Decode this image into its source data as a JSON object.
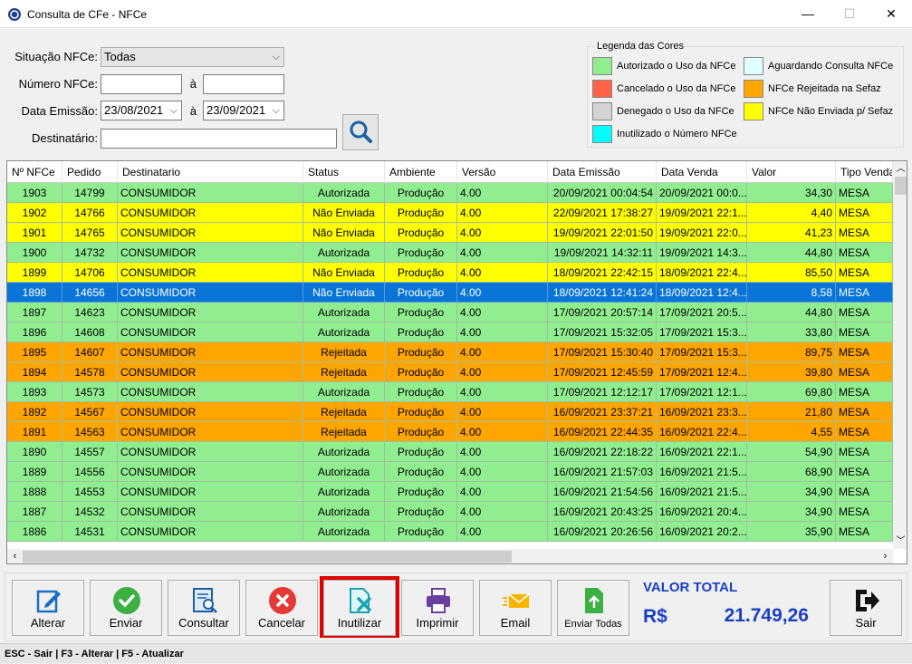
{
  "window": {
    "title": "Consulta de CFe - NFCe"
  },
  "filters": {
    "situacao_label": "Situação NFCe:",
    "situacao_value": "Todas",
    "numero_label": "Número NFCe:",
    "numero_from": "",
    "numero_to": "",
    "a_label": "à",
    "data_label": "Data Emissão:",
    "data_from": "23/08/2021",
    "data_to": "23/09/2021",
    "destinatario_label": "Destinatário:",
    "destinatario_value": ""
  },
  "legend": {
    "title": "Legenda das Cores",
    "items": [
      {
        "label": "Autorizado o Uso da NFCe",
        "color": "#90ee90"
      },
      {
        "label": "Aguardando Consulta NFCe",
        "color": "#e0ffff"
      },
      {
        "label": "Cancelado o Uso da NFCe",
        "color": "#ff6347"
      },
      {
        "label": "NFCe Rejeitada na Sefaz",
        "color": "#ffa500"
      },
      {
        "label": "Denegado o Uso da NFCe",
        "color": "#d3d3d3"
      },
      {
        "label": "NFCe Não Enviada p/ Sefaz",
        "color": "#ffff00"
      },
      {
        "label": "Inutilizado o Número NFCe",
        "color": "#00ffff"
      }
    ]
  },
  "grid": {
    "columns": [
      "Nº NFCe",
      "Pedido",
      "Destinatario",
      "Status",
      "Ambiente",
      "Versão",
      "Data Emissão",
      "Data Venda",
      "Valor",
      "Tipo Venda"
    ],
    "rows": [
      {
        "nfce": "1903",
        "pedido": "14799",
        "dest": "CONSUMIDOR",
        "status": "Autorizada",
        "amb": "Produção",
        "ver": "4.00",
        "emissao": "20/09/2021 00:04:54",
        "venda": "20/09/2021 00:0...",
        "valor": "34,30",
        "tipo": "MESA",
        "color": "#90ee90"
      },
      {
        "nfce": "1902",
        "pedido": "14766",
        "dest": "CONSUMIDOR",
        "status": "Não Enviada",
        "amb": "Produção",
        "ver": "4.00",
        "emissao": "22/09/2021 17:38:27",
        "venda": "19/09/2021 22:1...",
        "valor": "4,40",
        "tipo": "MESA",
        "color": "#ffff00"
      },
      {
        "nfce": "1901",
        "pedido": "14765",
        "dest": "CONSUMIDOR",
        "status": "Não Enviada",
        "amb": "Produção",
        "ver": "4.00",
        "emissao": "19/09/2021 22:01:50",
        "venda": "19/09/2021 22:0...",
        "valor": "41,23",
        "tipo": "MESA",
        "color": "#ffff00"
      },
      {
        "nfce": "1900",
        "pedido": "14732",
        "dest": "CONSUMIDOR",
        "status": "Autorizada",
        "amb": "Produção",
        "ver": "4.00",
        "emissao": "19/09/2021 14:32:11",
        "venda": "19/09/2021 14:3...",
        "valor": "44,80",
        "tipo": "MESA",
        "color": "#90ee90"
      },
      {
        "nfce": "1899",
        "pedido": "14706",
        "dest": "CONSUMIDOR",
        "status": "Não Enviada",
        "amb": "Produção",
        "ver": "4.00",
        "emissao": "18/09/2021 22:42:15",
        "venda": "18/09/2021 22:4...",
        "valor": "85,50",
        "tipo": "MESA",
        "color": "#ffff00"
      },
      {
        "nfce": "1898",
        "pedido": "14656",
        "dest": "CONSUMIDOR",
        "status": "Não Enviada",
        "amb": "Produção",
        "ver": "4.00",
        "emissao": "18/09/2021 12:41:24",
        "venda": "18/09/2021 12:4...",
        "valor": "8,58",
        "tipo": "MESA",
        "color": "#0a74d8",
        "selected": true
      },
      {
        "nfce": "1897",
        "pedido": "14623",
        "dest": "CONSUMIDOR",
        "status": "Autorizada",
        "amb": "Produção",
        "ver": "4.00",
        "emissao": "17/09/2021 20:57:14",
        "venda": "17/09/2021 20:5...",
        "valor": "44,80",
        "tipo": "MESA",
        "color": "#90ee90"
      },
      {
        "nfce": "1896",
        "pedido": "14608",
        "dest": "CONSUMIDOR",
        "status": "Autorizada",
        "amb": "Produção",
        "ver": "4.00",
        "emissao": "17/09/2021 15:32:05",
        "venda": "17/09/2021 15:3...",
        "valor": "33,80",
        "tipo": "MESA",
        "color": "#90ee90"
      },
      {
        "nfce": "1895",
        "pedido": "14607",
        "dest": "CONSUMIDOR",
        "status": "Rejeitada",
        "amb": "Produção",
        "ver": "4.00",
        "emissao": "17/09/2021 15:30:40",
        "venda": "17/09/2021 15:3...",
        "valor": "89,75",
        "tipo": "MESA",
        "color": "#ffa500"
      },
      {
        "nfce": "1894",
        "pedido": "14578",
        "dest": "CONSUMIDOR",
        "status": "Rejeitada",
        "amb": "Produção",
        "ver": "4.00",
        "emissao": "17/09/2021 12:45:59",
        "venda": "17/09/2021 12:4...",
        "valor": "39,80",
        "tipo": "MESA",
        "color": "#ffa500"
      },
      {
        "nfce": "1893",
        "pedido": "14573",
        "dest": "CONSUMIDOR",
        "status": "Autorizada",
        "amb": "Produção",
        "ver": "4.00",
        "emissao": "17/09/2021 12:12:17",
        "venda": "17/09/2021 12:1...",
        "valor": "69,80",
        "tipo": "MESA",
        "color": "#90ee90"
      },
      {
        "nfce": "1892",
        "pedido": "14567",
        "dest": "CONSUMIDOR",
        "status": "Rejeitada",
        "amb": "Produção",
        "ver": "4.00",
        "emissao": "16/09/2021 23:37:21",
        "venda": "16/09/2021 23:3...",
        "valor": "21,80",
        "tipo": "MESA",
        "color": "#ffa500"
      },
      {
        "nfce": "1891",
        "pedido": "14563",
        "dest": "CONSUMIDOR",
        "status": "Rejeitada",
        "amb": "Produção",
        "ver": "4.00",
        "emissao": "16/09/2021 22:44:35",
        "venda": "16/09/2021 22:4...",
        "valor": "4,55",
        "tipo": "MESA",
        "color": "#ffa500"
      },
      {
        "nfce": "1890",
        "pedido": "14557",
        "dest": "CONSUMIDOR",
        "status": "Autorizada",
        "amb": "Produção",
        "ver": "4.00",
        "emissao": "16/09/2021 22:18:22",
        "venda": "16/09/2021 22:1...",
        "valor": "54,90",
        "tipo": "MESA",
        "color": "#90ee90"
      },
      {
        "nfce": "1889",
        "pedido": "14556",
        "dest": "CONSUMIDOR",
        "status": "Autorizada",
        "amb": "Produção",
        "ver": "4.00",
        "emissao": "16/09/2021 21:57:03",
        "venda": "16/09/2021 21:5...",
        "valor": "68,90",
        "tipo": "MESA",
        "color": "#90ee90"
      },
      {
        "nfce": "1888",
        "pedido": "14553",
        "dest": "CONSUMIDOR",
        "status": "Autorizada",
        "amb": "Produção",
        "ver": "4.00",
        "emissao": "16/09/2021 21:54:56",
        "venda": "16/09/2021 21:5...",
        "valor": "34,90",
        "tipo": "MESA",
        "color": "#90ee90"
      },
      {
        "nfce": "1887",
        "pedido": "14532",
        "dest": "CONSUMIDOR",
        "status": "Autorizada",
        "amb": "Produção",
        "ver": "4.00",
        "emissao": "16/09/2021 20:43:25",
        "venda": "16/09/2021 20:4...",
        "valor": "34,90",
        "tipo": "MESA",
        "color": "#90ee90"
      },
      {
        "nfce": "1886",
        "pedido": "14531",
        "dest": "CONSUMIDOR",
        "status": "Autorizada",
        "amb": "Produção",
        "ver": "4.00",
        "emissao": "16/09/2021 20:26:56",
        "venda": "16/09/2021 20:2...",
        "valor": "35,90",
        "tipo": "MESA",
        "color": "#90ee90"
      }
    ]
  },
  "buttons": {
    "alterar": "Alterar",
    "enviar": "Enviar",
    "consultar": "Consultar",
    "cancelar": "Cancelar",
    "inutilizar": "Inutilizar",
    "imprimir": "Imprimir",
    "email": "Email",
    "enviar_todas": "Enviar Todas",
    "sair": "Sair"
  },
  "total": {
    "label": "VALOR TOTAL",
    "currency": "R$",
    "value": "21.749,26"
  },
  "statusbar": {
    "text": "ESC - Sair | F3 - Alterar  |  F5 - Atualizar"
  }
}
